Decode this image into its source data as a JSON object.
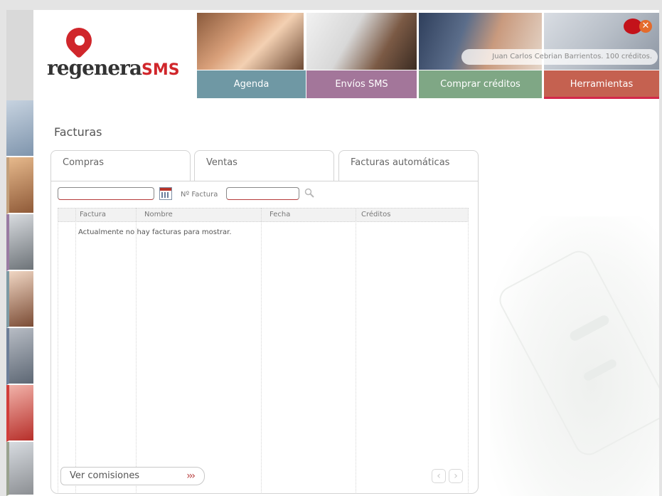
{
  "brand": {
    "name_main": "regenera",
    "name_sms": "SMS"
  },
  "header": {
    "user_info": "Juan Carlos  Cebrian Barrientos. 100 créditos.",
    "nav": [
      {
        "label": "Agenda",
        "color": "#6f98a4"
      },
      {
        "label": "Envíos SMS",
        "color": "#a3769a"
      },
      {
        "label": "Comprar créditos",
        "color": "#7fa785"
      },
      {
        "label": "Herramientas",
        "color": "#c56150"
      }
    ]
  },
  "main": {
    "title": "Facturas",
    "tabs": [
      {
        "label": "Compras",
        "active": true
      },
      {
        "label": "Ventas",
        "active": false
      },
      {
        "label": "Facturas automáticas",
        "active": false
      }
    ],
    "filters": {
      "date_value": "",
      "invoice_number_label": "Nº Factura",
      "invoice_number_value": ""
    },
    "table": {
      "columns": [
        "Factura",
        "Nombre",
        "Fecha",
        "Créditos"
      ],
      "rows": [],
      "empty_message": "Actualmente no hay facturas para mostrar."
    },
    "ver_comisiones_label": "Ver comisiones",
    "ver_comisiones_arrows": "›››",
    "pager": {
      "prev": "‹",
      "next": "›"
    }
  },
  "icons": {
    "close": "close-icon",
    "calendar": "calendar-icon",
    "search": "magnifier-icon"
  },
  "colors": {
    "accent_red": "#d0262b",
    "herramientas_underline": "#d4284a"
  }
}
